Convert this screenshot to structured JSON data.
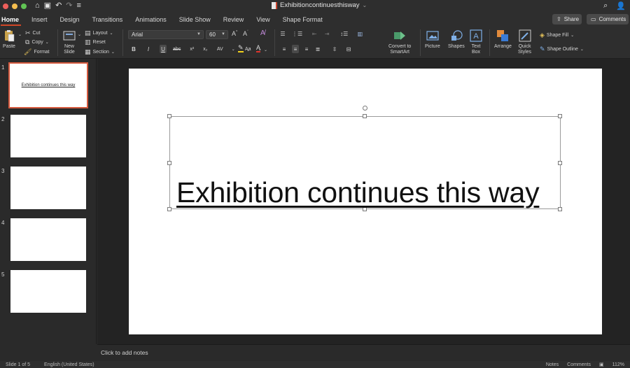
{
  "titlebar": {
    "doc_title": "Exhibitioncontinuesthisway",
    "title_chevron": "⌄"
  },
  "tabs": [
    {
      "label": "Home",
      "active": true
    },
    {
      "label": "Insert"
    },
    {
      "label": "Design"
    },
    {
      "label": "Transitions"
    },
    {
      "label": "Animations"
    },
    {
      "label": "Slide Show"
    },
    {
      "label": "Review"
    },
    {
      "label": "View"
    },
    {
      "label": "Shape Format"
    }
  ],
  "header_buttons": {
    "share": "Share",
    "comments": "Comments"
  },
  "ribbon": {
    "paste": "Paste",
    "cut": "Cut",
    "copy": "Copy",
    "format": "Format",
    "new_slide_line1": "New",
    "new_slide_line2": "Slide",
    "layout": "Layout",
    "reset": "Reset",
    "section": "Section",
    "font_name": "Arial",
    "font_size": "60",
    "convert_line1": "Convert to",
    "convert_line2": "SmartArt",
    "picture": "Picture",
    "shapes": "Shapes",
    "textbox_line1": "Text",
    "textbox_line2": "Box",
    "arrange": "Arrange",
    "quick_styles_line1": "Quick",
    "quick_styles_line2": "Styles",
    "shape_fill": "Shape Fill",
    "shape_outline": "Shape Outline"
  },
  "format_buttons": {
    "bold": "B",
    "italic": "I",
    "underline": "U",
    "strike": "abc",
    "superscript": "x²",
    "subscript": "x₂",
    "spacing": "AV",
    "case": "Aa"
  },
  "thumbnails": [
    {
      "num": "1",
      "text": "Exhibition continues this way",
      "selected": true
    },
    {
      "num": "2",
      "text": ""
    },
    {
      "num": "3",
      "text": ""
    },
    {
      "num": "4",
      "text": ""
    },
    {
      "num": "5",
      "text": ""
    }
  ],
  "slide": {
    "text": "Exhibition continues this way"
  },
  "notes_placeholder": "Click to add notes",
  "status": {
    "slide_info": "Slide 1 of 5",
    "language": "English (United States)",
    "notes": "Notes",
    "comments": "Comments",
    "zoom": "112%"
  },
  "colors": {
    "accent": "#d24726",
    "thumb_selected": "#d55a3f",
    "ribbon_bg": "#2e2e2e",
    "canvas_bg": "#232323"
  }
}
